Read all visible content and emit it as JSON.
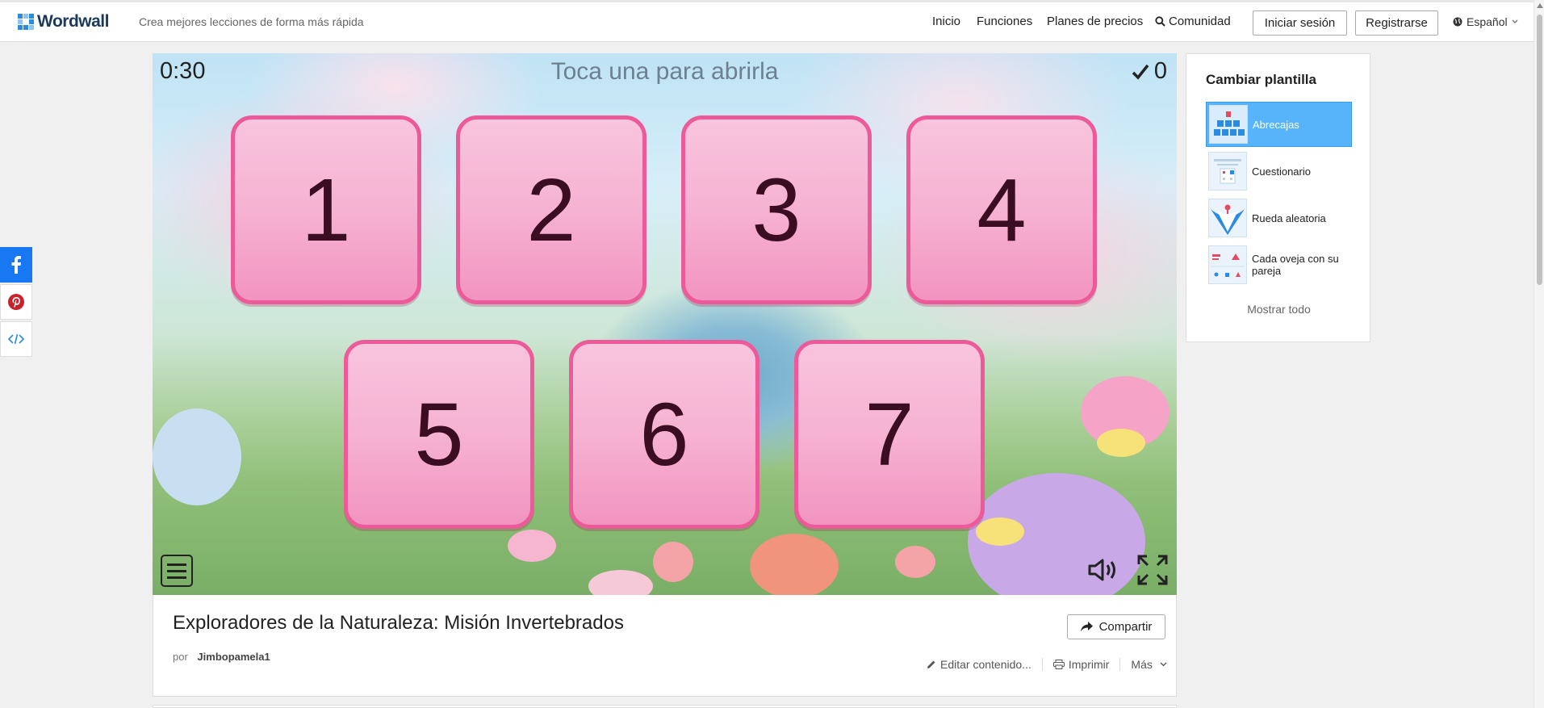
{
  "header": {
    "logo_text": "Wordwall",
    "tagline": "Crea mejores lecciones de forma más rápida",
    "nav": [
      "Inicio",
      "Funciones",
      "Planes de precios",
      "Comunidad"
    ],
    "login_label": "Iniciar sesión",
    "register_label": "Registrarse",
    "language": "Español",
    "brand_color": "#2a8be0"
  },
  "social": [
    "facebook-icon",
    "pinterest-icon",
    "embed-icon"
  ],
  "game": {
    "timer": "0:30",
    "prompt": "Toca una para abrirla",
    "score": "0",
    "tiles": [
      "1",
      "2",
      "3",
      "4",
      "5",
      "6",
      "7"
    ],
    "tile_color": "#f6b2d2",
    "tile_border_color": "#ec5a99"
  },
  "activity": {
    "title": "Exploradores de la Naturaleza: Misión Invertebrados",
    "by_label": "por",
    "author": "Jimbopamela1",
    "share_label": "Compartir",
    "edit_label": "Editar contenido...",
    "print_label": "Imprimir",
    "more_label": "Más"
  },
  "templates_panel": {
    "title": "Cambiar plantilla",
    "items": [
      {
        "label": "Abrecajas",
        "active": true
      },
      {
        "label": "Cuestionario",
        "active": false
      },
      {
        "label": "Rueda aleatoria",
        "active": false
      },
      {
        "label": "Cada oveja con su pareja",
        "active": false
      }
    ],
    "show_all_label": "Mostrar todo",
    "active_color": "#57b4fa"
  }
}
